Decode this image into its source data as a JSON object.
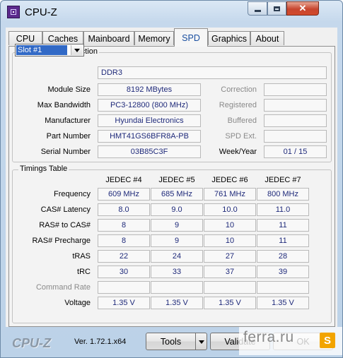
{
  "window": {
    "title": "CPU-Z",
    "icon": "cpuz-app-icon",
    "close_glyph": "✕"
  },
  "tabs": [
    "CPU",
    "Caches",
    "Mainboard",
    "Memory",
    "SPD",
    "Graphics",
    "About"
  ],
  "active_tab": "SPD",
  "slot_selection": {
    "group_title": "Memory Slot Selection",
    "selected_slot": "Slot #1",
    "memory_type": "DDR3",
    "module_size_label": "Module Size",
    "module_size": "8192 MBytes",
    "max_bandwidth_label": "Max Bandwidth",
    "max_bandwidth": "PC3-12800 (800 MHz)",
    "manufacturer_label": "Manufacturer",
    "manufacturer": "Hyundai Electronics",
    "part_number_label": "Part Number",
    "part_number": "HMT41GS6BFR8A-PB",
    "serial_number_label": "Serial Number",
    "serial_number": "03B85C3F",
    "correction_label": "Correction",
    "correction": "",
    "registered_label": "Registered",
    "registered": "",
    "buffered_label": "Buffered",
    "buffered": "",
    "spd_ext_label": "SPD Ext.",
    "spd_ext": "",
    "week_year_label": "Week/Year",
    "week_year": "01 / 15"
  },
  "timings": {
    "group_title": "Timings Table",
    "columns": [
      "JEDEC #4",
      "JEDEC #5",
      "JEDEC #6",
      "JEDEC #7"
    ],
    "rows": [
      {
        "label": "Frequency",
        "values": [
          "609 MHz",
          "685 MHz",
          "761 MHz",
          "800 MHz"
        ],
        "disabled": false
      },
      {
        "label": "CAS# Latency",
        "values": [
          "8.0",
          "9.0",
          "10.0",
          "11.0"
        ],
        "disabled": false
      },
      {
        "label": "RAS# to CAS#",
        "values": [
          "8",
          "9",
          "10",
          "11"
        ],
        "disabled": false
      },
      {
        "label": "RAS# Precharge",
        "values": [
          "8",
          "9",
          "10",
          "11"
        ],
        "disabled": false
      },
      {
        "label": "tRAS",
        "values": [
          "22",
          "24",
          "27",
          "28"
        ],
        "disabled": false
      },
      {
        "label": "tRC",
        "values": [
          "30",
          "33",
          "37",
          "39"
        ],
        "disabled": false
      },
      {
        "label": "Command Rate",
        "values": [
          "",
          "",
          "",
          ""
        ],
        "disabled": true
      },
      {
        "label": "Voltage",
        "values": [
          "1.35 V",
          "1.35 V",
          "1.35 V",
          "1.35 V"
        ],
        "disabled": false
      }
    ]
  },
  "footer": {
    "brand": "CPU-Z",
    "version": "Ver. 1.72.1.x64",
    "tools_label": "Tools",
    "validate_label": "Validate",
    "ok_label": "OK"
  },
  "watermark": {
    "text": "ferra.ru",
    "logo_glyph": "S"
  },
  "colors": {
    "value_text": "#1f2a7a",
    "active_tab_text": "#1a4fa0",
    "selection": "#3169c6",
    "close_button": "#c7462f"
  }
}
